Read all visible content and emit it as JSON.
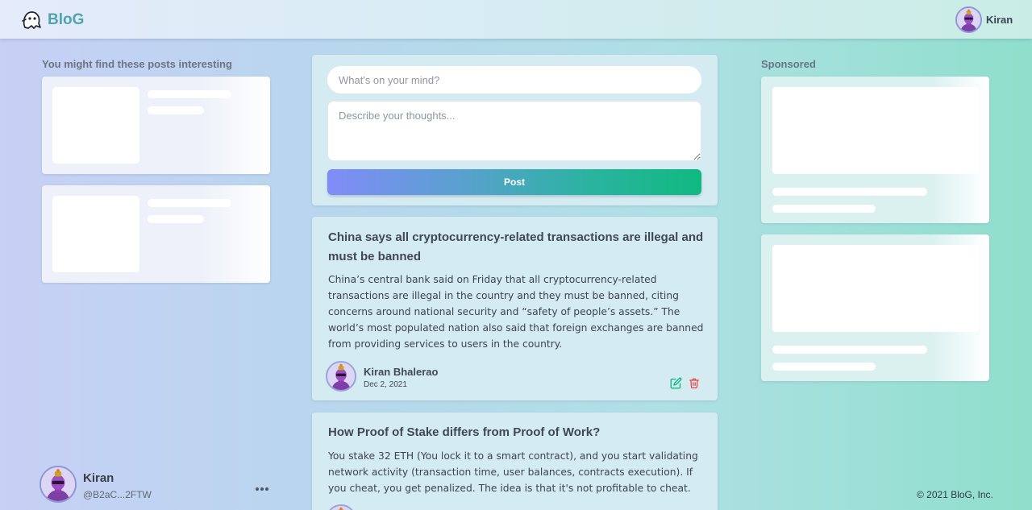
{
  "header": {
    "brand": "BloG",
    "logo_icon": "ghost-logo-icon",
    "profile_name": "Kiran"
  },
  "left": {
    "section_title": "You might find these posts interesting",
    "suggested_count_visible": 2
  },
  "composer": {
    "title_placeholder": "What's on your mind?",
    "body_placeholder": "Describe your thoughts...",
    "post_label": "Post"
  },
  "posts": [
    {
      "title": "China says all cryptocurrency-related transactions are illegal and must be banned",
      "body": "China’s central bank said on Friday that all cryptocurrency-related transactions are illegal in the country and they must be banned, citing concerns around national security and “safety of people’s assets.” The world’s most populated nation also said that foreign exchanges are banned from providing services to users in the country.",
      "author": "Kiran Bhalerao",
      "date": "Dec 2, 2021"
    },
    {
      "title": "How Proof of Stake differs from Proof of Work?",
      "body": "You stake 32 ETH (You lock it to a smart contract), and you start validating network activity (transaction time, user balances, contracts execution). If you cheat, you get penalized. The idea is that it's not profitable to cheat."
    }
  ],
  "right": {
    "section_title": "Sponsored"
  },
  "user": {
    "name": "Kiran",
    "handle": "@B2aC...2FTW"
  },
  "footer": {
    "copyright": "© 2021 BloG, Inc."
  },
  "colors": {
    "brand": "#4ea3ad",
    "post_button_start": "#818cf8",
    "post_button_end": "#10b981",
    "edit_icon": "#10b981",
    "delete_icon": "#ef4444"
  }
}
